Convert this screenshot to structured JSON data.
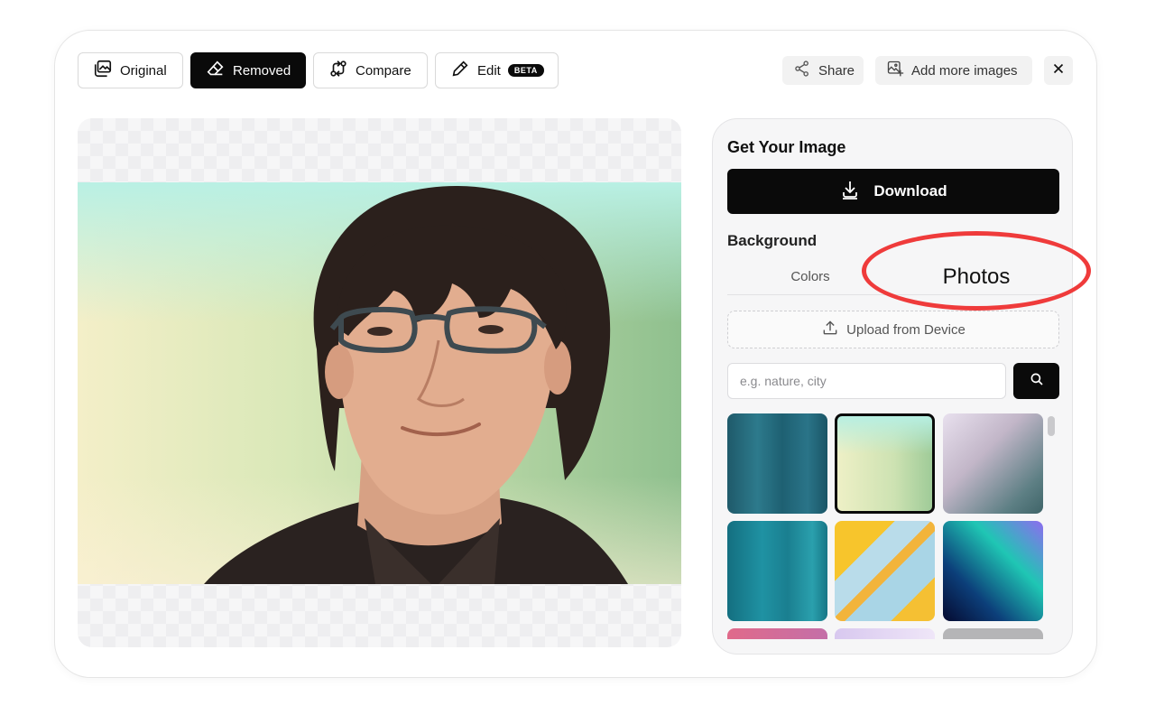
{
  "toolbar": {
    "original_label": "Original",
    "removed_label": "Removed",
    "compare_label": "Compare",
    "edit_label": "Edit",
    "edit_badge": "BETA",
    "share_label": "Share",
    "add_more_label": "Add more images"
  },
  "panel": {
    "title": "Get Your Image",
    "download_label": "Download",
    "background_label": "Background",
    "tabs": {
      "colors": "Colors",
      "photos": "Photos"
    },
    "upload_label": "Upload from Device",
    "search_placeholder": "e.g. nature, city"
  },
  "colors": {
    "primary_dark": "#0a0a0a",
    "annotation_red": "#ef3b3b"
  }
}
